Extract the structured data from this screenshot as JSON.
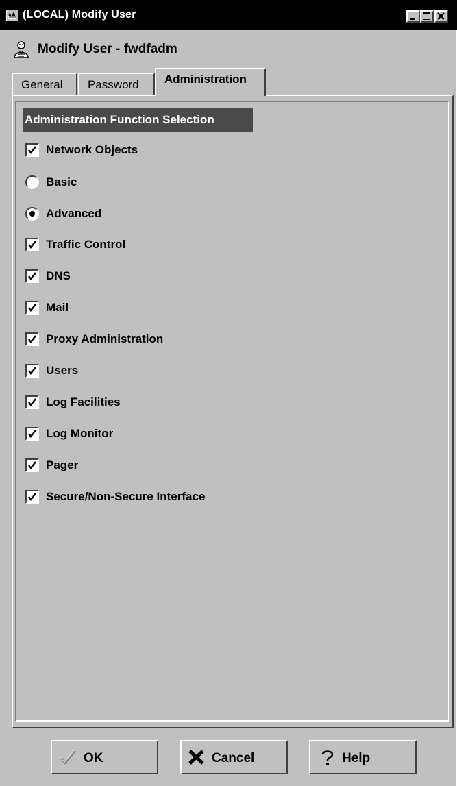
{
  "window": {
    "title": "(LOCAL) Modify User",
    "controls": [
      "minimize",
      "maximize",
      "close"
    ]
  },
  "header": {
    "icon": "user-icon",
    "title": "Modify User - fwdfadm"
  },
  "tabs": [
    {
      "label": "General",
      "active": false
    },
    {
      "label": "Password",
      "active": false
    },
    {
      "label": "Administration",
      "active": true
    }
  ],
  "section": {
    "title": "Administration Function Selection"
  },
  "options": [
    {
      "type": "checkbox",
      "label": "Network Objects",
      "checked": true
    },
    {
      "type": "radio",
      "label": "Basic",
      "checked": false
    },
    {
      "type": "radio",
      "label": "Advanced",
      "checked": true
    },
    {
      "type": "checkbox",
      "label": "Traffic Control",
      "checked": true
    },
    {
      "type": "checkbox",
      "label": "DNS",
      "checked": true
    },
    {
      "type": "checkbox",
      "label": "Mail",
      "checked": true
    },
    {
      "type": "checkbox",
      "label": "Proxy Administration",
      "checked": true
    },
    {
      "type": "checkbox",
      "label": "Users",
      "checked": true
    },
    {
      "type": "checkbox",
      "label": "Log Facilities",
      "checked": true
    },
    {
      "type": "checkbox",
      "label": "Log Monitor",
      "checked": true
    },
    {
      "type": "checkbox",
      "label": "Pager",
      "checked": true
    },
    {
      "type": "checkbox",
      "label": "Secure/Non-Secure Interface",
      "checked": true
    }
  ],
  "buttons": {
    "ok": {
      "label": "OK",
      "icon": "check-icon"
    },
    "cancel": {
      "label": "Cancel",
      "icon": "x-icon"
    },
    "help": {
      "label": "Help",
      "icon": "question-icon"
    }
  }
}
